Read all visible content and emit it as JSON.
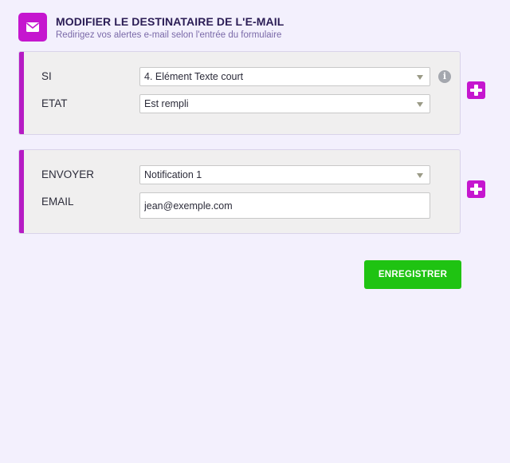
{
  "header": {
    "icon": "envelope-icon",
    "title": "MODIFIER LE DESTINATAIRE DE L'E-MAIL",
    "subtitle": "Redirigez vos alertes e-mail selon l'entrée du formulaire"
  },
  "condition": {
    "if_label": "SI",
    "if_value": "4. Elément Texte court",
    "state_label": "ETAT",
    "state_value": "Est rempli",
    "info_icon": "info-icon"
  },
  "action": {
    "send_label": "ENVOYER",
    "send_value": "Notification 1",
    "email_label": "EMAIL",
    "email_value": "jean@exemple.com"
  },
  "save_label": "ENREGISTRER",
  "colors": {
    "accent": "#c516cf",
    "save": "#1fc312",
    "background": "#f3f0fd",
    "card": "#f0efef"
  }
}
